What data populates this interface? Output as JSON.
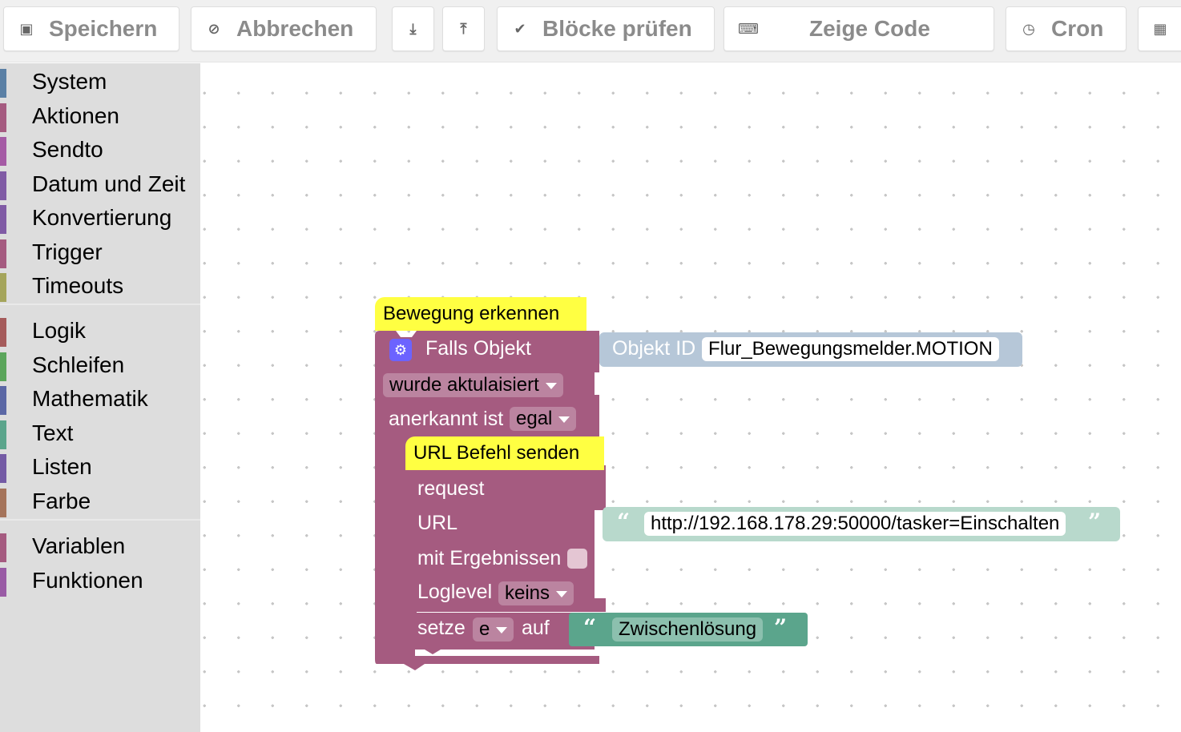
{
  "toolbar": {
    "save": {
      "label": "Speichern",
      "icon": "save-icon"
    },
    "cancel": {
      "label": "Abbrechen",
      "icon": "cancel-icon"
    },
    "export": {
      "icon": "download-icon"
    },
    "import": {
      "icon": "upload-icon"
    },
    "check": {
      "label": "Blöcke prüfen",
      "icon": "check-icon"
    },
    "show_code": {
      "label": "Zeige Code",
      "icon": "code-icon"
    },
    "cron": {
      "label": "Cron",
      "icon": "clock-icon"
    },
    "more": {
      "icon": "more-icon"
    }
  },
  "sidebar": {
    "items": [
      {
        "label": "System",
        "color": "#5b80a5"
      },
      {
        "label": "Aktionen",
        "color": "#a55b80"
      },
      {
        "label": "Sendto",
        "color": "#a55ba5"
      },
      {
        "label": "Datum und Zeit",
        "color": "#805ba5"
      },
      {
        "label": "Konvertierung",
        "color": "#805ba5"
      },
      {
        "label": "Trigger",
        "color": "#a55b80"
      },
      {
        "label": "Timeouts",
        "color": "#a5a55b"
      },
      {
        "label": "Logik",
        "color": "#a55b5b"
      },
      {
        "label": "Schleifen",
        "color": "#5ba55b"
      },
      {
        "label": "Mathematik",
        "color": "#5b67a5"
      },
      {
        "label": "Text",
        "color": "#5ba58c"
      },
      {
        "label": "Listen",
        "color": "#745ba5"
      },
      {
        "label": "Farbe",
        "color": "#a5745b"
      },
      {
        "label": "Variablen",
        "color": "#a55b80"
      },
      {
        "label": "Funktionen",
        "color": "#995ba5"
      }
    ]
  },
  "blocks": {
    "trigger": {
      "comment": "Bewegung erkennen",
      "title": "Falls Objekt",
      "object_label": "Objekt ID",
      "object_value": "Flur_Bewegungsmelder.MOTION",
      "event": "wurde aktulaisiert",
      "ack_label": "anerkannt ist",
      "ack_value": "egal",
      "color": "#a55b80"
    },
    "request": {
      "comment": "URL Befehl senden",
      "title": "request",
      "url_label": "URL",
      "url_value": "http://192.168.178.29:50000/tasker=Einschalten",
      "results_label": "mit Ergebnissen",
      "loglevel_label": "Loglevel",
      "loglevel_value": "keins"
    },
    "set_var": {
      "prefix": "setze",
      "variable": "e",
      "suffix": "auf",
      "text_value": "Zwischenlösung"
    }
  }
}
